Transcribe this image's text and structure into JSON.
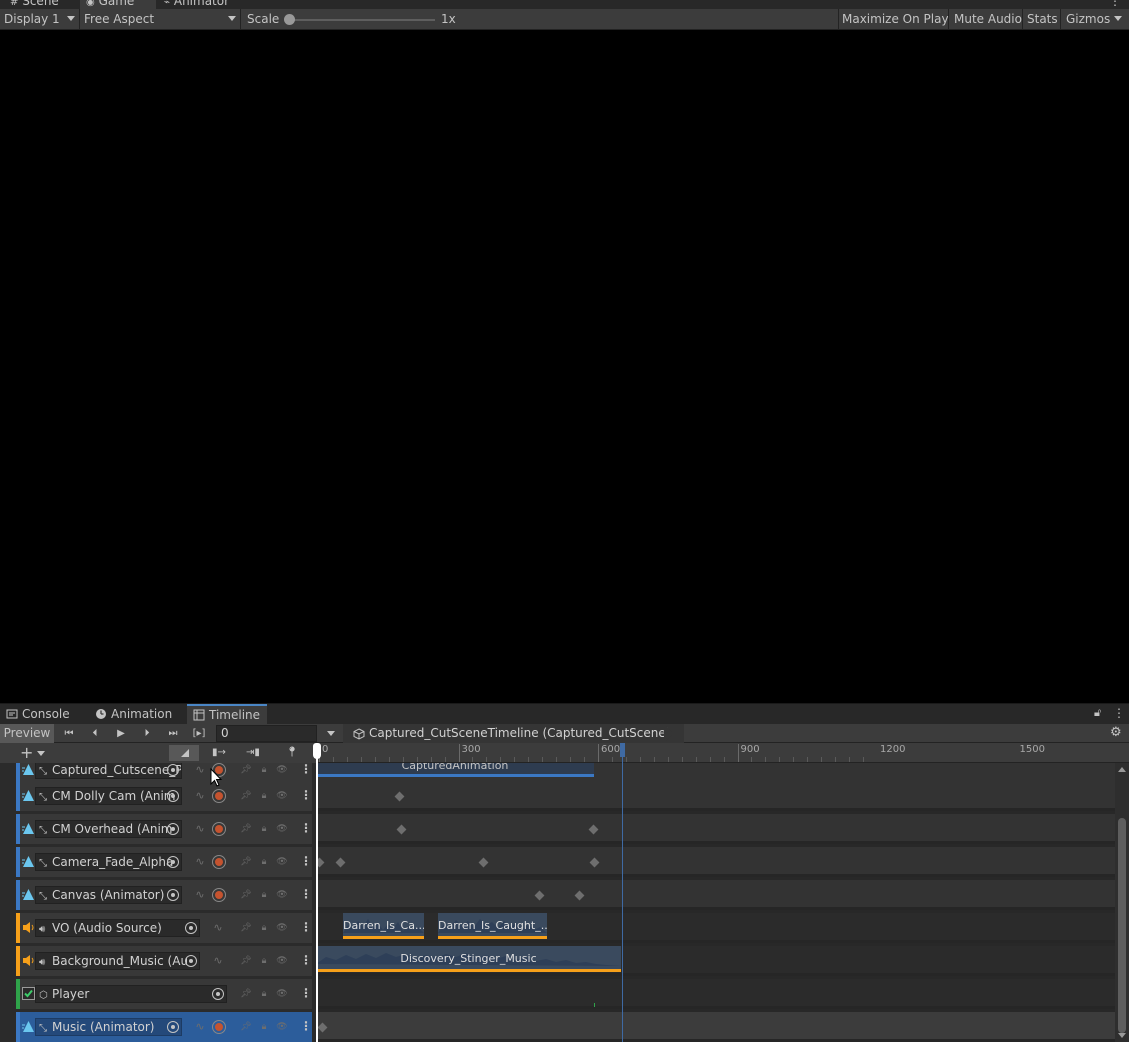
{
  "top_tabs": [
    {
      "label": "Scene",
      "icon": "hash-icon"
    },
    {
      "label": "Game",
      "icon": "gamepad-icon",
      "active": true
    },
    {
      "label": "Animator",
      "icon": "animator-icon"
    }
  ],
  "game_toolbar": {
    "display": "Display 1",
    "aspect": "Free Aspect",
    "scale_label": "Scale",
    "scale_value": "1x",
    "scale_fraction": 0.0,
    "maximize": "Maximize On Play",
    "mute": "Mute Audio",
    "stats": "Stats",
    "gizmos": "Gizmos"
  },
  "bottom_tabs": [
    {
      "label": "Console"
    },
    {
      "label": "Animation"
    },
    {
      "label": "Timeline",
      "active": true
    }
  ],
  "timeline_toolbar": {
    "preview": "Preview",
    "frame": "0",
    "asset": "Captured_CutSceneTimeline (Captured_CutScene)"
  },
  "ruler": {
    "labels": [
      "0",
      "300",
      "600",
      "900",
      "1200",
      "1500"
    ]
  },
  "tracks": [
    {
      "label": "Captured_Cutscene_Pl",
      "color": "#3b78c4"
    },
    {
      "label": "CM Dolly Cam (Anim",
      "color": "#3b78c4"
    },
    {
      "label": "CM Overhead (Anim",
      "color": "#3b78c4"
    },
    {
      "label": "Camera_Fade_Alpha",
      "color": "#3b78c4"
    },
    {
      "label": "Canvas (Animator)",
      "color": "#3b78c4"
    },
    {
      "label": "VO (Audio Source)",
      "color": "#f6a01a"
    },
    {
      "label": "Background_Music (Au",
      "color": "#f6a01a"
    },
    {
      "label": "Player",
      "color": "#2fa34a"
    },
    {
      "label": "Music (Animator)",
      "color": "#3b78c4"
    }
  ],
  "clips": {
    "captured": "CapturedAnimation",
    "vo1": "Darren_Is_Ca...",
    "vo2": "Darren_Is_Caught_...",
    "music": "Discovery_Stinger_Music"
  },
  "colors": {
    "anim": "#3b78c4",
    "audio": "#f6a01a",
    "activation": "#2fa34a",
    "selected": "#2c5d9b"
  }
}
